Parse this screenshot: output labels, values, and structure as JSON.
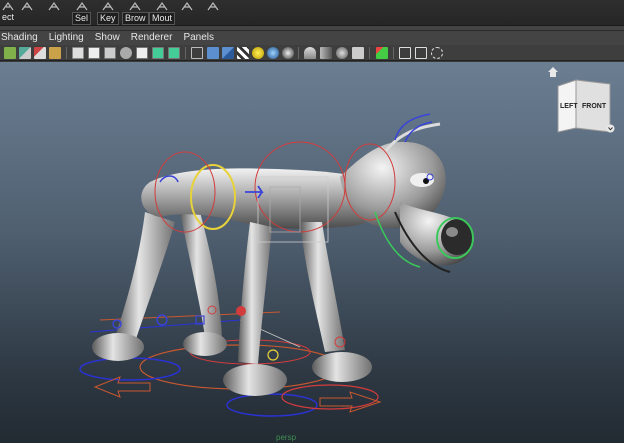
{
  "shelf": {
    "buttons": [
      {
        "label": "ect",
        "boxed": false
      },
      {
        "label": "",
        "boxed": false
      },
      {
        "label": "",
        "boxed": false
      },
      {
        "label": "Sel",
        "boxed": true
      },
      {
        "label": "Key",
        "boxed": true
      },
      {
        "label": "Brow",
        "boxed": true
      },
      {
        "label": "Mout",
        "boxed": true
      },
      {
        "label": "",
        "boxed": false
      },
      {
        "label": "",
        "boxed": false
      }
    ]
  },
  "menubar": {
    "items": [
      "Shading",
      "Lighting",
      "Show",
      "Renderer",
      "Panels"
    ]
  },
  "toolbar": {
    "icons": [
      "grid-icon",
      "camera-icon",
      "select-camera-icon",
      "lock-icon",
      "wireframe-icon",
      "film-gate-icon",
      "resolution-gate-icon",
      "safe-action-icon",
      "field-chart-icon",
      "text-icon",
      "wireframe-cube-icon",
      "smooth-shade-icon",
      "textured-icon",
      "lights-icon",
      "shadows-icon",
      "ambient-occlusion-icon",
      "motion-blur-icon",
      "anti-alias-icon",
      "depth-of-field-icon",
      "isolate-select-icon",
      "xray-icon",
      "xray-joints-icon",
      "xray-components-icon"
    ]
  },
  "viewcube": {
    "left_label": "LEFT",
    "front_label": "FRONT"
  },
  "viewport": {
    "camera_name": "persp"
  },
  "colors": {
    "shelf_bg": "#2a2a2a",
    "menubar_bg": "#444444",
    "viewport_top": "#6b7e92",
    "viewport_bottom": "#222a32",
    "ctrl_red": "#d23c3c",
    "ctrl_blue": "#3a44d8",
    "ctrl_yellow": "#e8d23a",
    "ctrl_green": "#3ac85a"
  }
}
